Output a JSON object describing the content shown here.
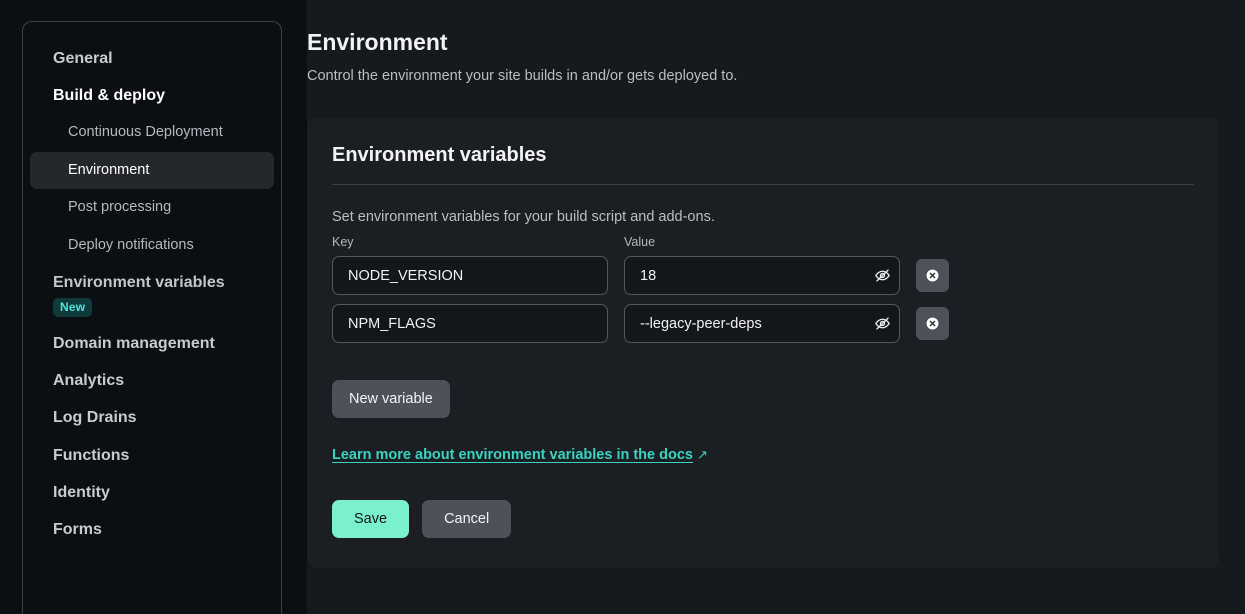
{
  "sidebar": {
    "items": [
      {
        "label": "General",
        "type": "top",
        "state": "normal"
      },
      {
        "label": "Build & deploy",
        "type": "top",
        "state": "active"
      },
      {
        "label": "Continuous Deployment",
        "type": "sub",
        "state": "normal"
      },
      {
        "label": "Environment",
        "type": "sub",
        "state": "selected"
      },
      {
        "label": "Post processing",
        "type": "sub",
        "state": "normal"
      },
      {
        "label": "Deploy notifications",
        "type": "sub",
        "state": "normal"
      },
      {
        "label": "Environment variables",
        "type": "badge",
        "badge": "New"
      },
      {
        "label": "Domain management",
        "type": "top",
        "state": "normal"
      },
      {
        "label": "Analytics",
        "type": "top",
        "state": "normal"
      },
      {
        "label": "Log Drains",
        "type": "top",
        "state": "normal"
      },
      {
        "label": "Functions",
        "type": "top",
        "state": "normal"
      },
      {
        "label": "Identity",
        "type": "top",
        "state": "normal"
      },
      {
        "label": "Forms",
        "type": "top",
        "state": "normal"
      }
    ]
  },
  "page": {
    "title": "Environment",
    "subtitle": "Control the environment your site builds in and/or gets deployed to."
  },
  "card": {
    "title": "Environment variables",
    "description": "Set environment variables for your build script and add-ons.",
    "columns": {
      "key": "Key",
      "value": "Value"
    },
    "variables": [
      {
        "key": "NODE_VERSION",
        "value": "18"
      },
      {
        "key": "NPM_FLAGS",
        "value": "--legacy-peer-deps"
      }
    ],
    "new_variable_label": "New variable",
    "docs_link": {
      "text": "Learn more about environment variables in the docs",
      "external_glyph": "↗"
    },
    "save_label": "Save",
    "cancel_label": "Cancel"
  },
  "icons": {
    "eye_off": "eye-off-icon",
    "delete": "delete-circle-icon"
  },
  "colors": {
    "page_bg": "#16191d",
    "sidebar_bg": "#0b0e12",
    "card_bg": "#1b1e23",
    "accent_mint": "#7af0cc",
    "accent_teal": "#3ad3c0",
    "badge_bg": "#0e3a3a",
    "badge_text": "#4fe3d8",
    "button_gray": "#4d525a"
  }
}
